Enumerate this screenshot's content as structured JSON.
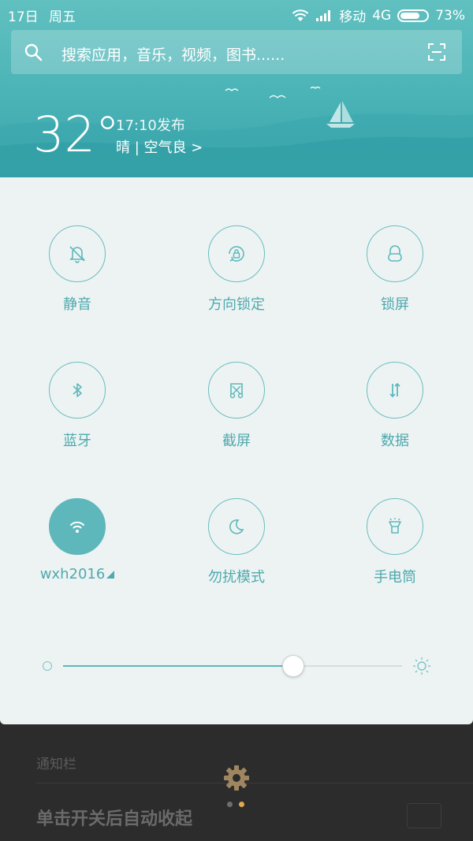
{
  "status_bar": {
    "date": "17日",
    "weekday": "周五",
    "carrier": "移动",
    "network": "4G",
    "battery_text": "73%",
    "battery_level": 0.73
  },
  "search": {
    "placeholder": "搜索应用，音乐，视频，图书......"
  },
  "weather": {
    "temperature": "32°",
    "publish_time": "17:10发布",
    "condition": "晴 | 空气良 >"
  },
  "toggles": [
    {
      "label": "静音",
      "icon": "bell-off-icon",
      "active": false
    },
    {
      "label": "方向锁定",
      "icon": "rotation-lock-icon",
      "active": false
    },
    {
      "label": "锁屏",
      "icon": "lock-icon",
      "active": false
    },
    {
      "label": "蓝牙",
      "icon": "bluetooth-icon",
      "active": false
    },
    {
      "label": "截屏",
      "icon": "screenshot-icon",
      "active": false
    },
    {
      "label": "数据",
      "icon": "data-arrows-icon",
      "active": false
    },
    {
      "label": "wxh2016",
      "icon": "wifi-icon",
      "active": true
    },
    {
      "label": "勿扰模式",
      "icon": "moon-icon",
      "active": false
    },
    {
      "label": "手电筒",
      "icon": "flashlight-icon",
      "active": false
    }
  ],
  "brightness": {
    "level": 0.68
  },
  "notification": {
    "heading": "通知栏",
    "auto_collapse_label": "单击开关后自动收起",
    "current_page": 2,
    "page_count": 2
  },
  "colors": {
    "accent": "#5eb8bb",
    "header_bg": "#4ab3b6",
    "panel_bg": "#edf3f3"
  }
}
